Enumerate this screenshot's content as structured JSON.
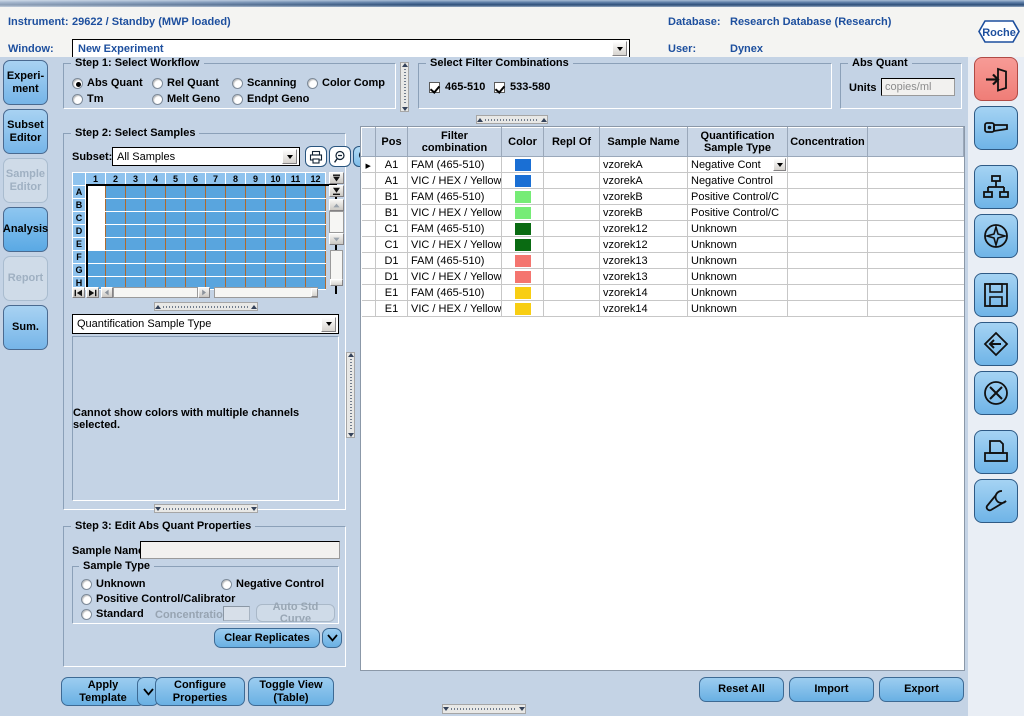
{
  "header": {
    "instrument_label": "Instrument:",
    "instrument_value": "29622 / Standby (MWP loaded)",
    "window_label": "Window:",
    "window_value": "New Experiment",
    "database_label": "Database:",
    "database_value": "Research Database (Research)",
    "user_label": "User:",
    "user_value": "Dynex",
    "brand": "Roche"
  },
  "nav": {
    "items": [
      {
        "label": "Experi-\nment",
        "line1": "Experi-",
        "line2": "ment",
        "enabled": true,
        "selected": false
      },
      {
        "label": "Subset Editor",
        "line1": "Subset",
        "line2": "Editor",
        "enabled": true,
        "selected": false
      },
      {
        "label": "Sample Editor",
        "line1": "Sample",
        "line2": "Editor",
        "enabled": false,
        "selected": false
      },
      {
        "label": "Analysis",
        "line1": "Analysis",
        "line2": "",
        "enabled": true,
        "selected": true
      },
      {
        "label": "Report",
        "line1": "Report",
        "line2": "",
        "enabled": false,
        "selected": false
      },
      {
        "label": "Sum.",
        "line1": "Sum.",
        "line2": "",
        "enabled": true,
        "selected": false
      }
    ]
  },
  "step1": {
    "title": "Step 1: Select Workflow",
    "options": [
      {
        "label": "Abs Quant",
        "selected": true
      },
      {
        "label": "Rel Quant",
        "selected": false
      },
      {
        "label": "Scanning",
        "selected": false
      },
      {
        "label": "Color Comp",
        "selected": false
      },
      {
        "label": "Tm",
        "selected": false
      },
      {
        "label": "Melt Geno",
        "selected": false
      },
      {
        "label": "Endpt Geno",
        "selected": false
      }
    ]
  },
  "filter_combinations": {
    "title": "Select Filter Combinations",
    "items": [
      {
        "label": "465-510",
        "checked": true
      },
      {
        "label": "533-580",
        "checked": true
      }
    ]
  },
  "abs_quant": {
    "title": "Abs Quant",
    "units_label": "Units",
    "units_value": "copies/ml"
  },
  "step2": {
    "title": "Step 2: Select Samples",
    "subset_label": "Subset:",
    "subset_value": "All Samples",
    "tools": [
      {
        "name": "print-icon",
        "tip": "Print"
      },
      {
        "name": "zoom-out-icon",
        "tip": "Zoom Out"
      },
      {
        "name": "zoom-in-icon",
        "tip": "Zoom In"
      },
      {
        "name": "zoom-reset-icon",
        "tip": "Zoom Reset"
      }
    ],
    "plate": {
      "columns": [
        "1",
        "2",
        "3",
        "4",
        "5",
        "6",
        "7",
        "8",
        "9",
        "10",
        "11",
        "12"
      ],
      "rows": [
        "A",
        "B",
        "C",
        "D",
        "E",
        "F",
        "G",
        "H"
      ],
      "empty_wells": [
        "A1",
        "B1",
        "C1",
        "D1",
        "E1"
      ]
    },
    "color_by_value": "Quantification Sample Type",
    "color_message": "Cannot show colors with multiple channels selected."
  },
  "step3": {
    "title": "Step 3: Edit Abs Quant Properties",
    "sample_name_label": "Sample Name",
    "sample_name_value": "",
    "sample_type": {
      "title": "Sample Type",
      "options": [
        {
          "label": "Unknown",
          "selected": false
        },
        {
          "label": "Negative Control",
          "selected": false
        },
        {
          "label": "Positive Control/Calibrator",
          "selected": false
        },
        {
          "label": "Standard",
          "selected": false
        }
      ],
      "concentration_label": "Concentration",
      "concentration_value": "",
      "auto_std_curve_label": "Auto Std Curve"
    },
    "clear_replicates_label": "Clear Replicates"
  },
  "table": {
    "columns": [
      {
        "key": "pos",
        "label": "Pos"
      },
      {
        "key": "filter",
        "label": "Filter combination"
      },
      {
        "key": "color",
        "label": "Color"
      },
      {
        "key": "repl",
        "label": "Repl Of"
      },
      {
        "key": "name",
        "label": "Sample Name"
      },
      {
        "key": "qst",
        "label": "Quantification Sample Type"
      },
      {
        "key": "conc",
        "label": "Concentration"
      }
    ],
    "rows": [
      {
        "selected": true,
        "pos": "A1",
        "filter": "FAM (465-510)",
        "color": "#1a6fd4",
        "repl": "",
        "name": "vzorekA",
        "qst": "Negative Cont",
        "qst_dropdown": true,
        "conc": ""
      },
      {
        "selected": false,
        "pos": "A1",
        "filter": "VIC / HEX / Yellow",
        "color": "#1a6fd4",
        "repl": "",
        "name": "vzorekA",
        "qst": "Negative Control",
        "qst_dropdown": false,
        "conc": ""
      },
      {
        "selected": false,
        "pos": "B1",
        "filter": "FAM (465-510)",
        "color": "#76ec76",
        "repl": "",
        "name": "vzorekB",
        "qst": "Positive Control/C",
        "qst_dropdown": false,
        "conc": ""
      },
      {
        "selected": false,
        "pos": "B1",
        "filter": "VIC / HEX / Yellow",
        "color": "#76ec76",
        "repl": "",
        "name": "vzorekB",
        "qst": "Positive Control/C",
        "qst_dropdown": false,
        "conc": ""
      },
      {
        "selected": false,
        "pos": "C1",
        "filter": "FAM (465-510)",
        "color": "#0a6b12",
        "repl": "",
        "name": "vzorek12",
        "qst": "Unknown",
        "qst_dropdown": false,
        "conc": ""
      },
      {
        "selected": false,
        "pos": "C1",
        "filter": "VIC / HEX / Yellow",
        "color": "#0a6b12",
        "repl": "",
        "name": "vzorek12",
        "qst": "Unknown",
        "qst_dropdown": false,
        "conc": ""
      },
      {
        "selected": false,
        "pos": "D1",
        "filter": "FAM (465-510)",
        "color": "#f4756f",
        "repl": "",
        "name": "vzorek13",
        "qst": "Unknown",
        "qst_dropdown": false,
        "conc": ""
      },
      {
        "selected": false,
        "pos": "D1",
        "filter": "VIC / HEX / Yellow",
        "color": "#f4756f",
        "repl": "",
        "name": "vzorek13",
        "qst": "Unknown",
        "qst_dropdown": false,
        "conc": ""
      },
      {
        "selected": false,
        "pos": "E1",
        "filter": "FAM (465-510)",
        "color": "#f8ce13",
        "repl": "",
        "name": "vzorek14",
        "qst": "Unknown",
        "qst_dropdown": false,
        "conc": ""
      },
      {
        "selected": false,
        "pos": "E1",
        "filter": "VIC / HEX / Yellow",
        "color": "#f8ce13",
        "repl": "",
        "name": "vzorek14",
        "qst": "Unknown",
        "qst_dropdown": false,
        "conc": ""
      }
    ]
  },
  "bottom": {
    "apply_template": "Apply Template",
    "apply_template_l1": "Apply",
    "apply_template_l2": "Template",
    "configure_properties_l1": "Configure",
    "configure_properties_l2": "Properties",
    "toggle_view_l1": "Toggle View",
    "toggle_view_l2": "(Table)",
    "reset_all": "Reset All",
    "import": "Import",
    "export": "Export"
  },
  "rail": {
    "items": [
      {
        "name": "logout-icon",
        "accent": "#ef7d77"
      },
      {
        "name": "key-icon",
        "accent": "#6fb4e7"
      },
      {
        "name": "hierarchy-icon",
        "accent": "#6fb4e7"
      },
      {
        "name": "navigator-icon",
        "accent": "#6fb4e7"
      },
      {
        "name": "save-icon",
        "accent": "#6fb4e7"
      },
      {
        "name": "back-icon",
        "accent": "#6fb4e7"
      },
      {
        "name": "close-icon",
        "accent": "#6fb4e7"
      },
      {
        "name": "print-icon",
        "accent": "#6fb4e7"
      },
      {
        "name": "tools-icon",
        "accent": "#6fb4e7"
      }
    ]
  },
  "colors": {
    "panel_bg": "#c4d3e5",
    "accent_blue": "#1d4f9e",
    "button_blue": "#69b0e3",
    "well_blue": "#59a5de"
  }
}
